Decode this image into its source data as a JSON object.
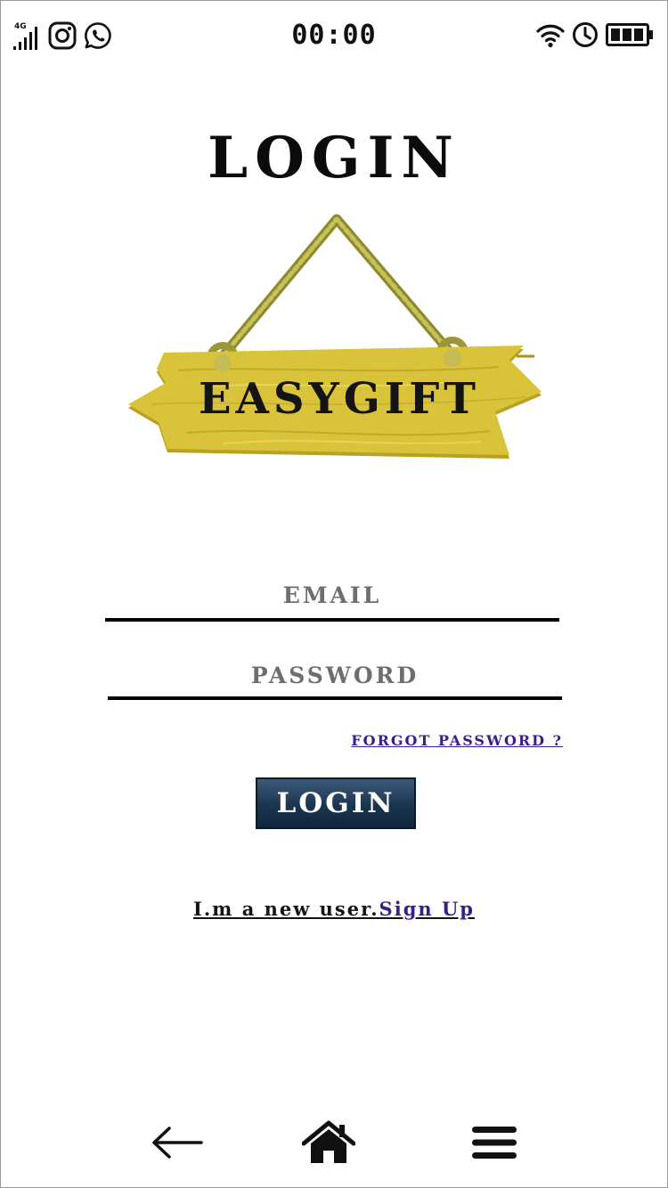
{
  "status_bar": {
    "network": "4G",
    "time": "00:00",
    "icons": [
      "signal-icon",
      "instagram-icon",
      "whatsapp-icon",
      "wifi-icon",
      "alarm-clock-icon",
      "battery-icon"
    ]
  },
  "page": {
    "title": "LOGIN",
    "logo_text": "EASYGIFT"
  },
  "form": {
    "email_placeholder": "EMAIL",
    "email_value": "",
    "password_placeholder": "PASSWORD",
    "password_value": "",
    "forgot_password": "FORGOT PASSWORD ?",
    "login_button": "LOGIN"
  },
  "signup": {
    "prompt": "I.m a new user.",
    "link": "Sign Up"
  },
  "bottom_nav": {
    "icons": [
      "back-arrow-icon",
      "home-icon",
      "menu-icon"
    ]
  },
  "colors": {
    "accent_link": "#3a1d8c",
    "button_dark": "#1b3550",
    "sign_wood": "#d4bb2f"
  }
}
